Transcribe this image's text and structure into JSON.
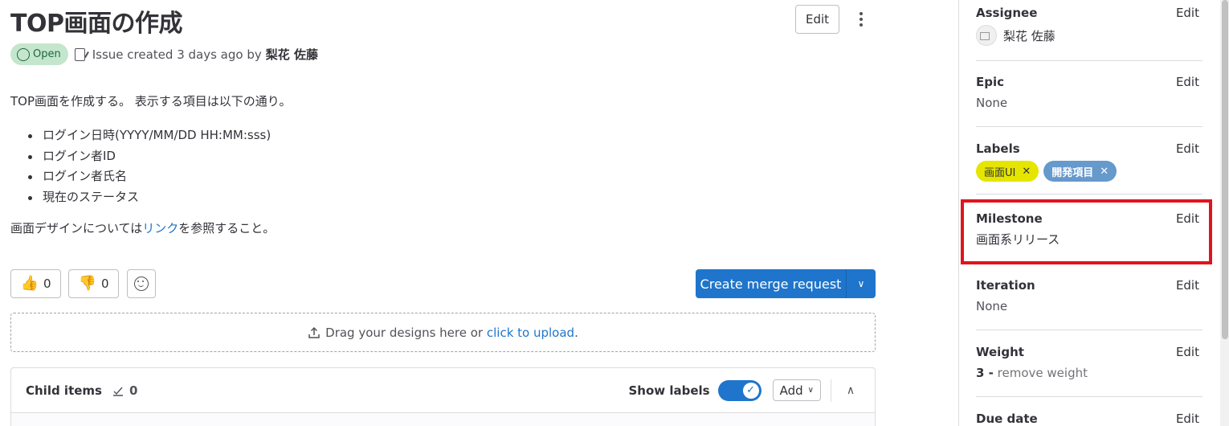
{
  "issue": {
    "title": "TOP画面の作成",
    "edit_label": "Edit",
    "status": "Open",
    "created_text": "Issue created 3 days ago by",
    "author": "梨花 佐藤"
  },
  "description": {
    "intro": "TOP画面を作成する。 表示する項目は以下の通り。",
    "items": [
      "ログイン日時(YYYY/MM/DD HH:MM:sss)",
      "ログイン者ID",
      "ログイン者氏名",
      "現在のステータス"
    ],
    "p2_before": "画面デザインについては",
    "p2_link": "リンク",
    "p2_after": "を参照すること。"
  },
  "reactions": {
    "thumbs_up_count": "0",
    "thumbs_down_count": "0"
  },
  "merge_button": {
    "label": "Create merge request"
  },
  "upload": {
    "text": "Drag your designs here or",
    "link": "click to upload",
    "end": "."
  },
  "child_items": {
    "title": "Child items",
    "count": "0",
    "show_labels": "Show labels",
    "add_label": "Add"
  },
  "sidebar": {
    "edit_label": "Edit",
    "assignee": {
      "label": "Assignee",
      "value": "梨花 佐藤"
    },
    "epic": {
      "label": "Epic",
      "value": "None"
    },
    "labels": {
      "label": "Labels",
      "chips": [
        "画面UI",
        "開発項目"
      ]
    },
    "milestone": {
      "label": "Milestone",
      "value": "画面系リリース"
    },
    "iteration": {
      "label": "Iteration",
      "value": "None"
    },
    "weight": {
      "label": "Weight",
      "value": "3 -",
      "remove": "remove weight"
    },
    "due_date": {
      "label": "Due date"
    }
  },
  "colors": {
    "primary": "#1f75cb",
    "open_badge_bg": "#c3e6cd",
    "label_yellow": "#e5e500",
    "label_blue": "#6699cc",
    "highlight_red": "#e0141e"
  }
}
